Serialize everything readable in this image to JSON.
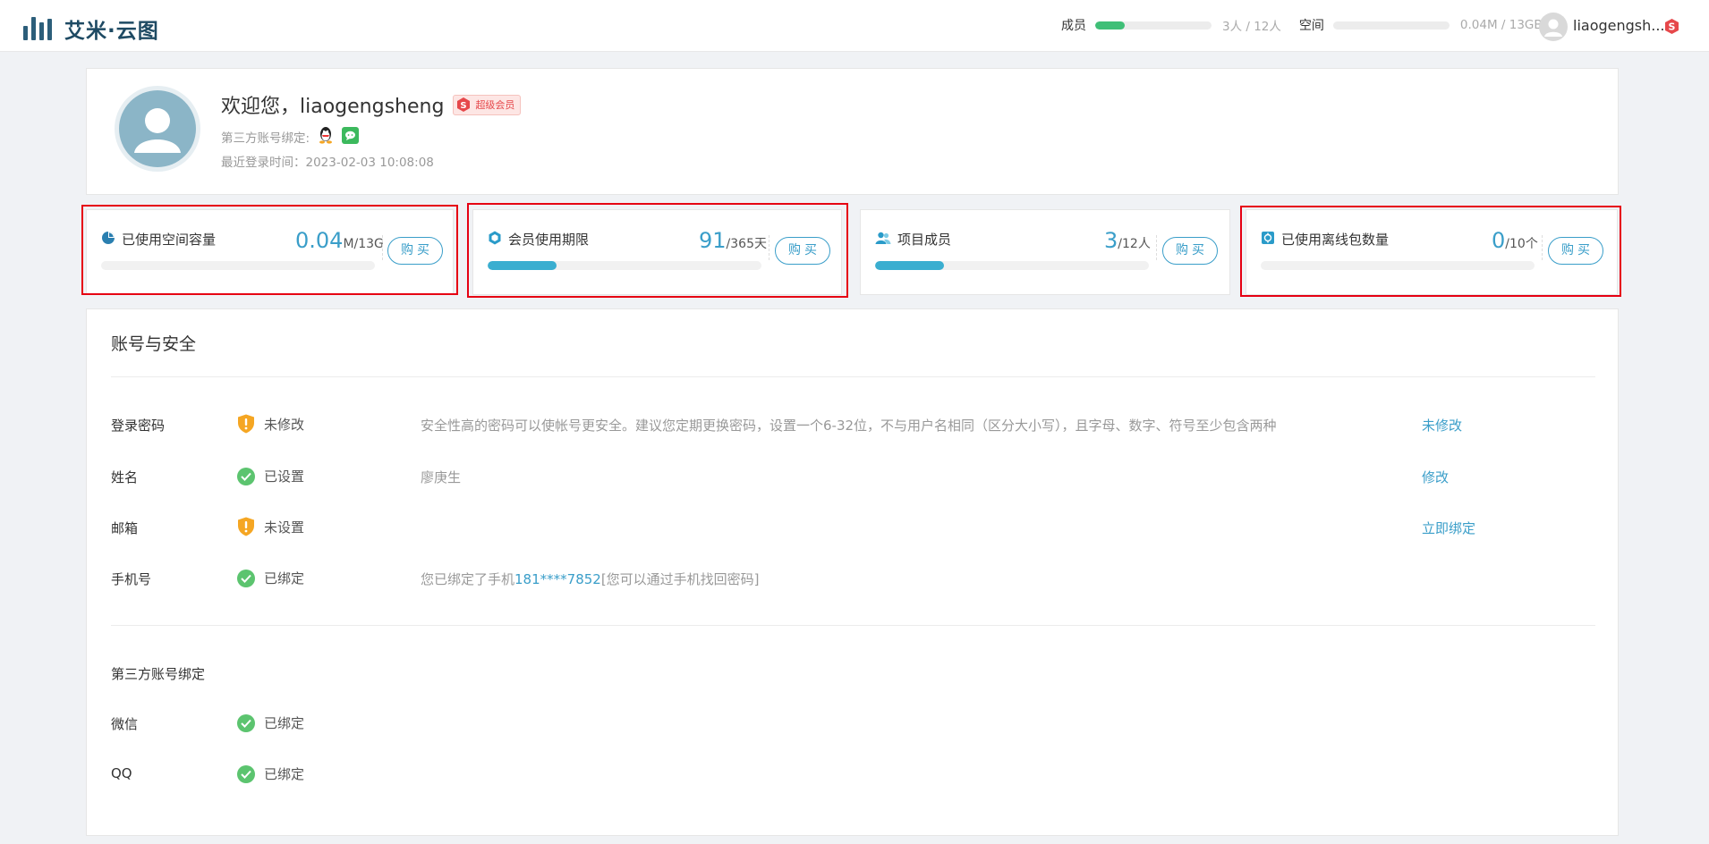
{
  "header": {
    "brand": "艾米·云图",
    "members_label": "成员",
    "members_value": "3人 / 12人",
    "members_fraction": 0.25,
    "space_label": "空间",
    "space_value": "0.04M / 13GB",
    "space_fraction": 0.0,
    "username": "liaogengsh..."
  },
  "profile": {
    "welcome": "欢迎您，liaogengsheng",
    "vip_label": "超级会员",
    "bind_label": "第三方账号绑定:",
    "last_login": "最近登录时间：2023-02-03 10:08:08"
  },
  "stats": [
    {
      "title": "已使用空间容量",
      "value": "0.04",
      "unit": "M/13G",
      "fraction": 0.0,
      "buy": "购买",
      "icon": "pie-chart-icon"
    },
    {
      "title": "会员使用期限",
      "value": "91",
      "unit": "/365天",
      "fraction": 0.25,
      "buy": "购买",
      "icon": "hexagon-icon"
    },
    {
      "title": "项目成员",
      "value": "3",
      "unit": "/12人",
      "fraction": 0.25,
      "buy": "购买",
      "icon": "users-icon"
    },
    {
      "title": "已使用离线包数量",
      "value": "0",
      "unit": "/10个",
      "fraction": 0.0,
      "buy": "购买",
      "icon": "package-icon"
    }
  ],
  "security": {
    "title": "账号与安全",
    "rows": [
      {
        "label": "登录密码",
        "status": "未修改",
        "status_type": "warn",
        "desc": "安全性高的密码可以使帐号更安全。建议您定期更换密码，设置一个6-32位，不与用户名相同（区分大小写），且字母、数字、符号至少包含两种",
        "action": "未修改"
      },
      {
        "label": "姓名",
        "status": "已设置",
        "status_type": "ok",
        "desc": "廖庚生",
        "action": "修改"
      },
      {
        "label": "邮箱",
        "status": "未设置",
        "status_type": "warn",
        "desc": "",
        "action": "立即绑定"
      },
      {
        "label": "手机号",
        "status": "已绑定",
        "status_type": "ok",
        "desc_prefix": "您已绑定了手机",
        "phone": "181****7852",
        "desc_suffix": "[您可以通过手机找回密码]",
        "action": ""
      }
    ],
    "third_party_title": "第三方账号绑定",
    "third_party": [
      {
        "label": "微信",
        "status": "已绑定"
      },
      {
        "label": "QQ",
        "status": "已绑定"
      }
    ]
  },
  "colors": {
    "accent": "#3a9ec9",
    "success": "#5cc46f",
    "warning": "#f5a623",
    "highlight_box": "#e60012"
  }
}
